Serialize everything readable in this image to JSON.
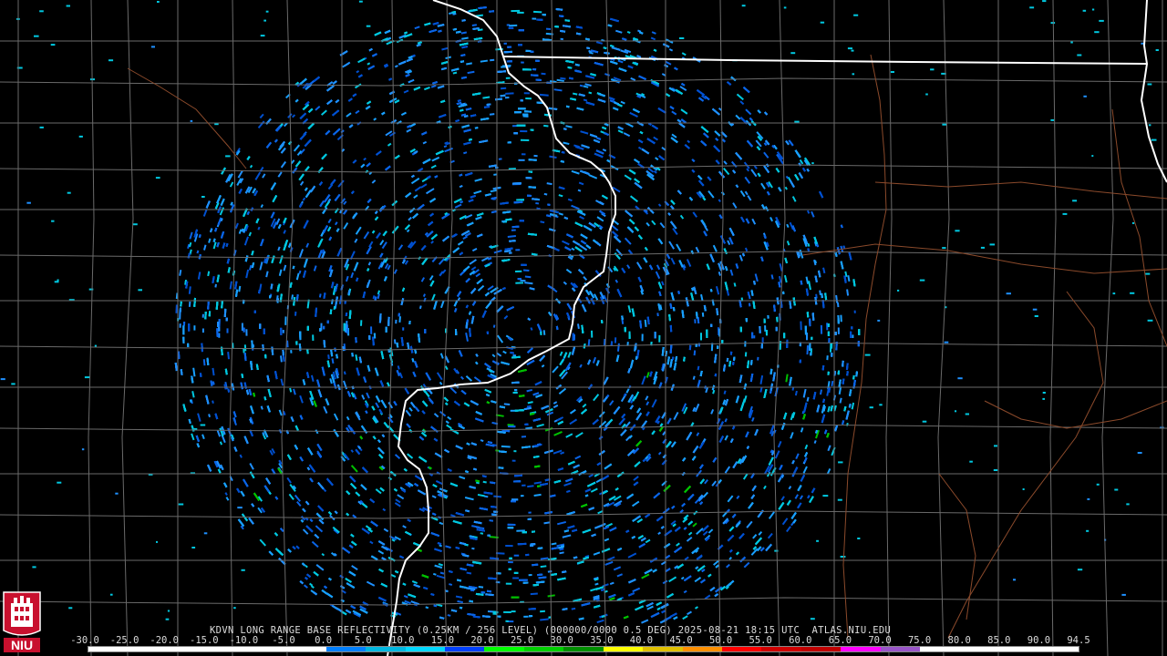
{
  "caption": "KDVN LONG RANGE BASE REFLECTIVITY (0.25KM / 256 LEVEL) (000000/0000 0.5 DEG) 2025-08-21 18:15 UTC  ATLAS.NIU.EDU",
  "logo": {
    "text": "NIU",
    "icon": "niu-seal-icon",
    "color": "#c8102e"
  },
  "scale": {
    "tick_labels": [
      "-30.0",
      "-25.0",
      "-20.0",
      "-15.0",
      "-10.0",
      "-5.0",
      "0.0",
      "5.0",
      "10.0",
      "15.0",
      "20.0",
      "25.0",
      "30.0",
      "35.0",
      "40.0",
      "45.0",
      "50.0",
      "55.0",
      "60.0",
      "65.0",
      "70.0",
      "75.0",
      "80.0",
      "85.0",
      "90.0",
      "94.5"
    ],
    "colors": [
      "#ffffff",
      "#ffffff",
      "#ffffff",
      "#ffffff",
      "#ffffff",
      "#ffffff",
      "#0080ff",
      "#00b7e0",
      "#00d8ff",
      "#0040ff",
      "#00ff00",
      "#00d000",
      "#009000",
      "#ffff00",
      "#e0c000",
      "#ff9000",
      "#ff0000",
      "#d00000",
      "#c00000",
      "#ff00ff",
      "#9955c8",
      "#ffffff",
      "#ffffff",
      "#ffffff",
      "#ffffff"
    ]
  },
  "colors": {
    "background": "#000000",
    "county_lines": "#6e6e6e",
    "state_lines": "#ffffff",
    "highways": "#8b4a2b",
    "echo_primary": "#1e90ff",
    "echo_secondary": "#00c8e0",
    "echo_green": "#00c000"
  }
}
